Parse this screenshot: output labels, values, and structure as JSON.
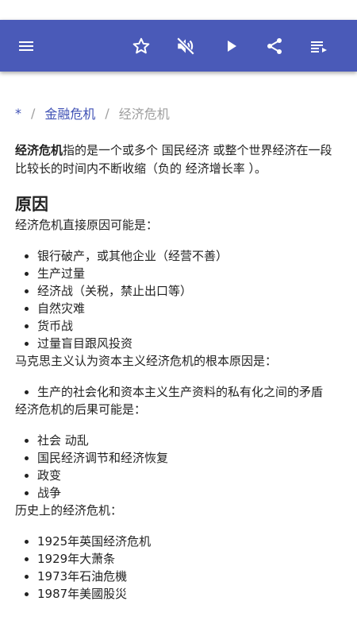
{
  "toolbar": {
    "menu_icon": "menu-icon",
    "star_icon": "star-icon",
    "mute_icon": "volume-off-icon",
    "play_icon": "play-icon",
    "share_icon": "share-icon",
    "list_icon": "playlist-icon",
    "accent": "#4a5ab8"
  },
  "breadcrumb": {
    "home": "*",
    "parent": "金融危机",
    "current": "经济危机"
  },
  "article": {
    "intro_bold": "经济危机",
    "intro_rest": "指的是一个或多个 国民经济 或整个世界经济在一段比较长的时间内不断收缩（负的 经济增长率 ）。",
    "heading": "原因",
    "cause_intro": "经济危机直接原因可能是：",
    "causes": [
      "银行破产，或其他企业（经营不善）",
      "生产过量",
      "经济战（关税，禁止出口等）",
      "自然灾难",
      "货币战",
      "过量盲目跟风投资"
    ],
    "marx_intro": "马克思主义认为资本主义经济危机的根本原因是：",
    "marx": [
      "生产的社会化和资本主义生产资料的私有化之间的矛盾"
    ],
    "result_intro": "经济危机的后果可能是：",
    "results": [
      "社会 动乱",
      "国民经济调节和经济恢复",
      "政变",
      "战争"
    ],
    "history_intro": "历史上的经济危机：",
    "history": [
      "1925年英国经济危机",
      "1929年大萧条",
      "1973年石油危機",
      "1987年美國股災"
    ]
  }
}
